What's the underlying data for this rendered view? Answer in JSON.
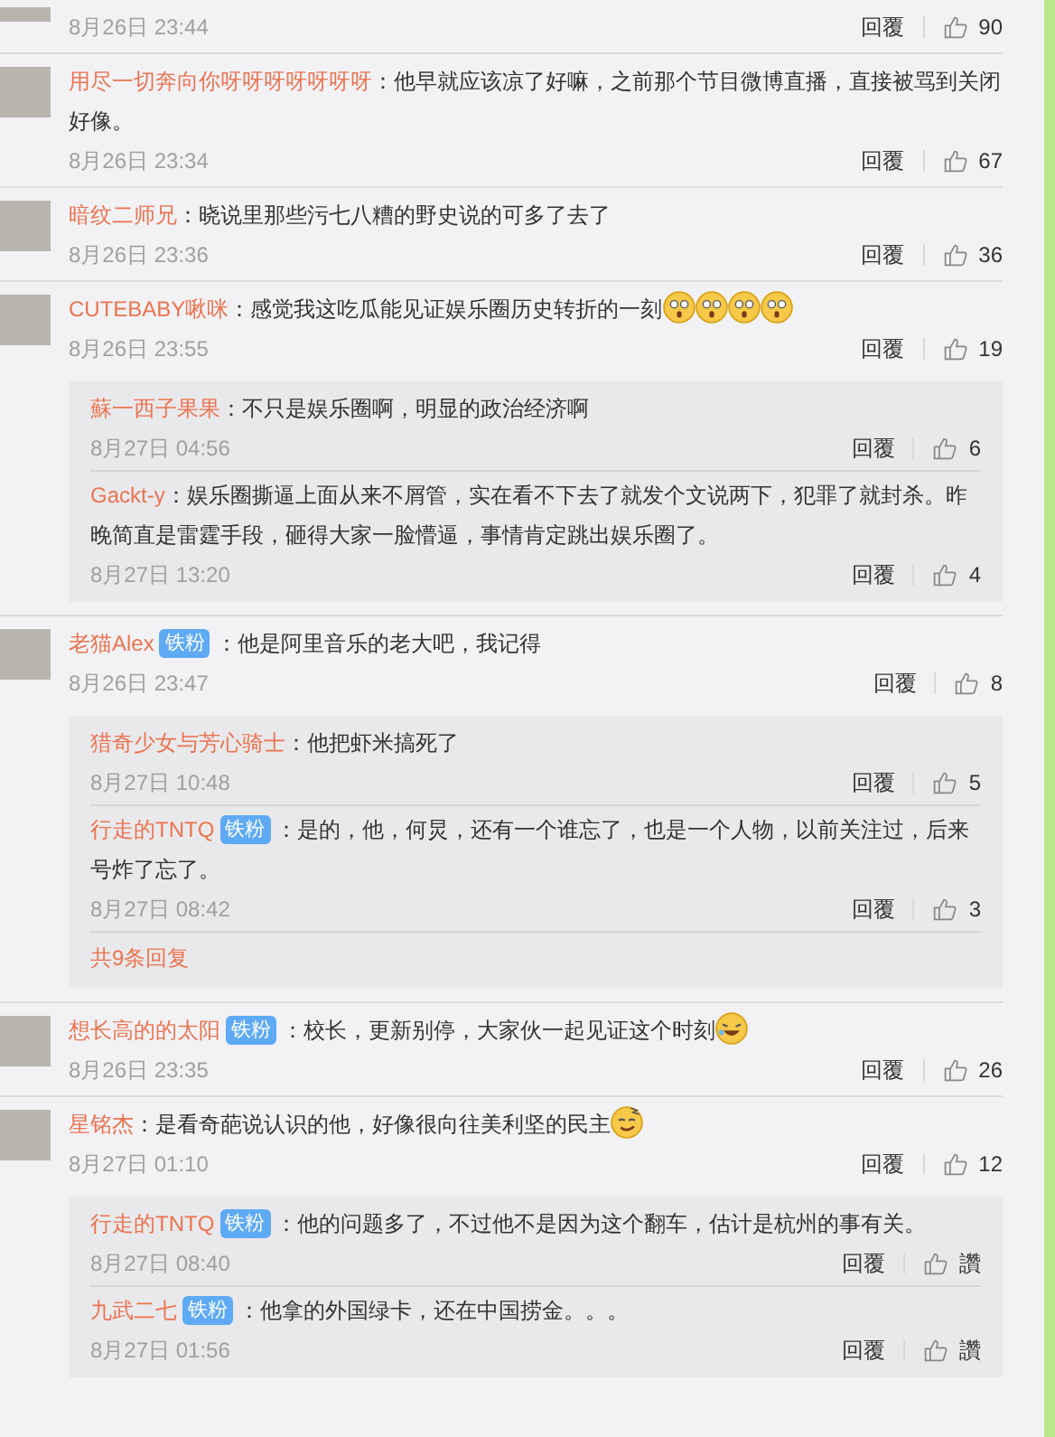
{
  "comments": [
    {
      "time": "8月26日 23:44",
      "reply_label": "回覆",
      "likes": "90"
    },
    {
      "name": "用尽一切奔向你呀呀呀呀呀呀呀",
      "text": "：他早就应该凉了好嘛，之前那个节目微博直播，直接被骂到关闭好像。",
      "time": "8月26日 23:34",
      "reply_label": "回覆",
      "likes": "67"
    },
    {
      "name": "暗纹二师兄",
      "text": "：晓说里那些污七八糟的野史说的可多了去了",
      "time": "8月26日 23:36",
      "reply_label": "回覆",
      "likes": "36"
    },
    {
      "name": "CUTEBABY啾咪",
      "text": "：感觉我这吃瓜能见证娱乐圈历史转折的一刻",
      "emoji": [
        {
          "kind": "surprised"
        },
        {
          "kind": "surprised"
        },
        {
          "kind": "surprised"
        },
        {
          "kind": "surprised"
        }
      ],
      "time": "8月26日 23:55",
      "reply_label": "回覆",
      "likes": "19",
      "replies": [
        {
          "name": "蘇一西子果果",
          "text": "：不只是娱乐圈啊，明显的政治经济啊",
          "time": "8月27日 04:56",
          "reply_label": "回覆",
          "likes": "6"
        },
        {
          "name": "Gackt-y",
          "text": "：娱乐圈撕逼上面从来不屑管，实在看不下去了就发个文说两下，犯罪了就封杀。昨晚简直是雷霆手段，砸得大家一脸懵逼，事情肯定跳出娱乐圈了。",
          "time": "8月27日 13:20",
          "reply_label": "回覆",
          "likes": "4"
        }
      ]
    },
    {
      "name": "老猫Alex",
      "badge": "铁粉",
      "text": "：他是阿里音乐的老大吧，我记得",
      "time": "8月26日 23:47",
      "reply_label": "回覆",
      "likes": "8",
      "replies": [
        {
          "name": "猎奇少女与芳心骑士",
          "text": "：他把虾米搞死了",
          "time": "8月27日 10:48",
          "reply_label": "回覆",
          "likes": "5"
        },
        {
          "name": "行走的TNTQ",
          "badge": "铁粉",
          "text": "：是的，他，何炅，还有一个谁忘了，也是一个人物，以前关注过，后来号炸了忘了。",
          "time": "8月27日 08:42",
          "reply_label": "回覆",
          "likes": "3"
        }
      ],
      "more_replies": "共9条回复"
    },
    {
      "name": "想长高的的太阳",
      "badge": "铁粉",
      "text": "：校长，更新别停，大家伙一起见证这个时刻",
      "emoji": [
        {
          "kind": "laughing"
        }
      ],
      "time": "8月26日 23:35",
      "reply_label": "回覆",
      "likes": "26"
    },
    {
      "name": "星铭杰",
      "text": "：是看奇葩说认识的他，好像很向往美利坚的民主",
      "emoji": [
        {
          "kind": "smirking"
        }
      ],
      "time": "8月27日 01:10",
      "reply_label": "回覆",
      "likes": "12",
      "replies": [
        {
          "name": "行走的TNTQ",
          "badge": "铁粉",
          "text": "：他的问题多了，不过他不是因为这个翻车，估计是杭州的事有关。",
          "time": "8月27日 08:40",
          "reply_label": "回覆",
          "likes": "讚"
        },
        {
          "name": "九武二七",
          "badge": "铁粉",
          "text": "：他拿的外国绿卡，还在中国捞金。。。",
          "time": "8月27日 01:56",
          "reply_label": "回覆",
          "likes": "讚"
        }
      ]
    }
  ]
}
